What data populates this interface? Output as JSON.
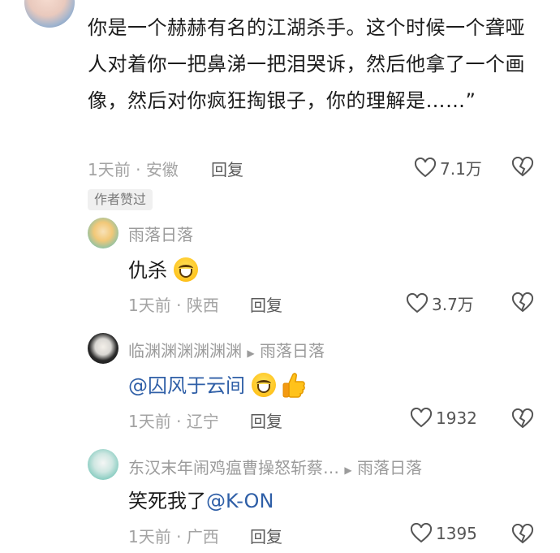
{
  "main_comment": {
    "text": "你是一个赫赫有名的江湖杀手。这个时候一个聋哑人对着你一把鼻涕一把泪哭诉，然后他拿了一个画像，然后对你疯狂掏银子，你的理解是……”",
    "time": "1天前",
    "location": "安徽",
    "reply_label": "回复",
    "likes": "7.1万",
    "badge": "作者赞过"
  },
  "replies": [
    {
      "username": "雨落日落",
      "reply_to": "",
      "text": "仇杀",
      "time": "1天前",
      "location": "陕西",
      "reply_label": "回复",
      "likes": "3.7万"
    },
    {
      "username": "临渊渊渊渊渊渊",
      "reply_to": "雨落日落",
      "mention": "@囚风于云间",
      "time": "1天前",
      "location": "辽宁",
      "reply_label": "回复",
      "likes": "1932"
    },
    {
      "username": "东汉末年闹鸡瘟曹操怒斩蔡…",
      "reply_to": "雨落日落",
      "text": "笑死我了",
      "mention": "@K-ON",
      "time": "1天前",
      "location": "广西",
      "reply_label": "回复",
      "likes": "1395"
    }
  ],
  "separator": "·",
  "icons": {
    "like": "heart-outline-icon",
    "dislike": "broken-heart-icon",
    "reply_arrow": "triangle-right-icon",
    "emoji": "grinning-face-emoji",
    "thumbs_up": "thumbs-up-emoji"
  }
}
